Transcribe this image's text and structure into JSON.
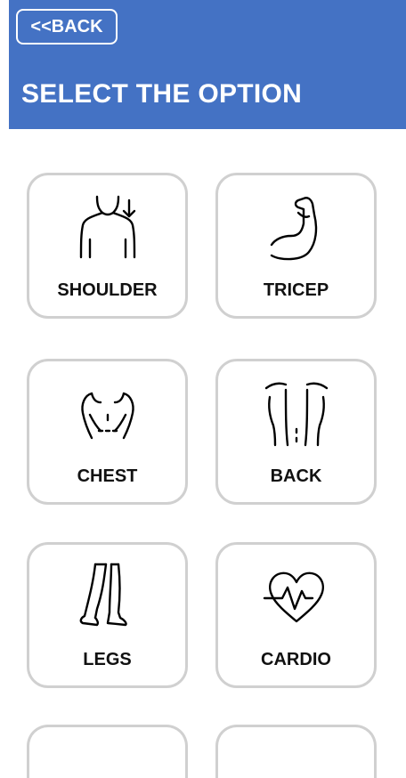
{
  "header": {
    "back_label": "<<BACK",
    "title": "SELECT THE OPTION",
    "background": "#4472c4"
  },
  "options": [
    {
      "label": "SHOULDER",
      "icon": "shoulder-icon"
    },
    {
      "label": "TRICEP",
      "icon": "flexed-arm-icon"
    },
    {
      "label": "CHEST",
      "icon": "chest-icon"
    },
    {
      "label": "BACK",
      "icon": "back-muscles-icon"
    },
    {
      "label": "LEGS",
      "icon": "legs-icon"
    },
    {
      "label": "CARDIO",
      "icon": "heartbeat-icon"
    }
  ],
  "colors": {
    "card_border": "#d0d0d0",
    "text": "#111111"
  }
}
